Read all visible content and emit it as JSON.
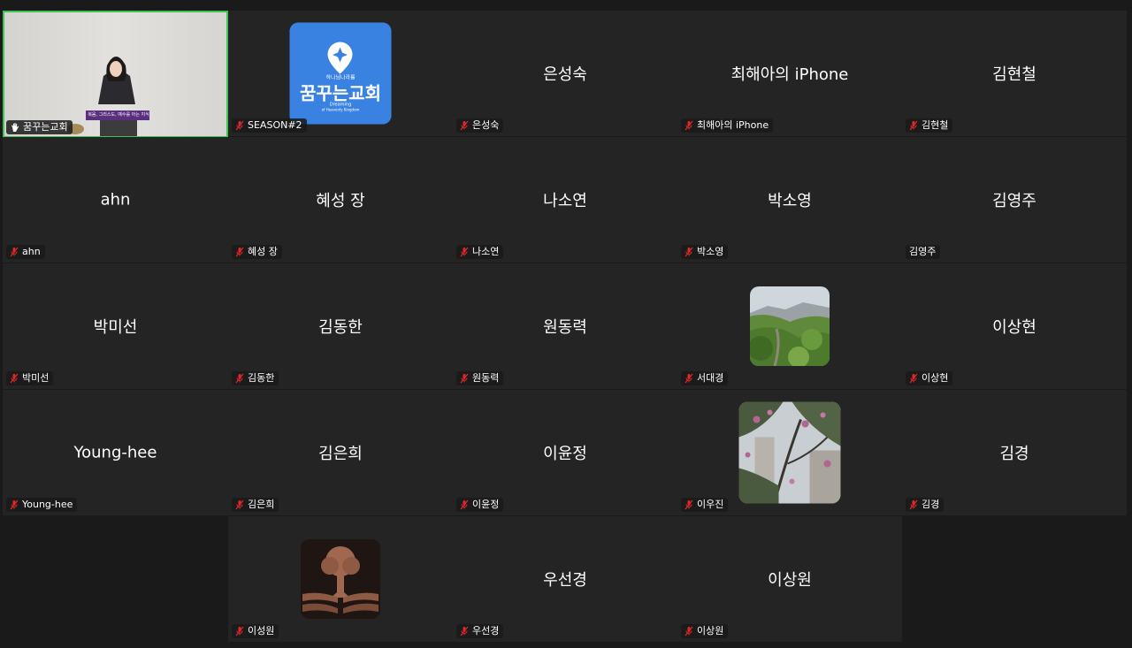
{
  "active_speaker": {
    "name": "꿈꾸는교회",
    "banner_text": "복음, 그리스도, 예수를 아는 지식"
  },
  "logo": {
    "line1": "하나님나라를",
    "line2": "꿈꾸는교회",
    "line3": "Dreaming",
    "line4": "of Heavenly Kingdom"
  },
  "participants": [
    {
      "center": "",
      "tag": "SEASON#2",
      "muted": true
    },
    {
      "center": "은성숙",
      "tag": "은성숙",
      "muted": true
    },
    {
      "center": "최해아의 iPhone",
      "tag": "최해아의 iPhone",
      "muted": true
    },
    {
      "center": "김현철",
      "tag": "김현철",
      "muted": true
    },
    {
      "center": "ahn",
      "tag": "ahn",
      "muted": true
    },
    {
      "center": "혜성 장",
      "tag": "혜성 장",
      "muted": true
    },
    {
      "center": "나소연",
      "tag": "나소연",
      "muted": true
    },
    {
      "center": "박소영",
      "tag": "박소영",
      "muted": true
    },
    {
      "center": "김영주",
      "tag": "김영주",
      "muted": false
    },
    {
      "center": "박미선",
      "tag": "박미선",
      "muted": true
    },
    {
      "center": "김동한",
      "tag": "김동한",
      "muted": true
    },
    {
      "center": "원동력",
      "tag": "원동력",
      "muted": true
    },
    {
      "center": "",
      "tag": "서대경",
      "muted": true
    },
    {
      "center": "이상현",
      "tag": "이상현",
      "muted": true
    },
    {
      "center": "Young-hee",
      "tag": "Young-hee",
      "muted": true
    },
    {
      "center": "김은희",
      "tag": "김은희",
      "muted": true
    },
    {
      "center": "이윤정",
      "tag": "이윤정",
      "muted": true
    },
    {
      "center": "",
      "tag": "이우진",
      "muted": true
    },
    {
      "center": "김경",
      "tag": "김경",
      "muted": true
    },
    {
      "center": "",
      "tag": "이성원",
      "muted": true
    },
    {
      "center": "우선경",
      "tag": "우선경",
      "muted": true
    },
    {
      "center": "이상원",
      "tag": "이상원",
      "muted": true
    }
  ],
  "colors": {
    "background": "#1a1a1a",
    "tile": "#242424",
    "active_border": "#3fc454",
    "muted_mic": "#e02828",
    "text": "#ffffff"
  },
  "icons": {
    "muted": "mic-muted-icon",
    "hand": "raised-hand-icon"
  }
}
